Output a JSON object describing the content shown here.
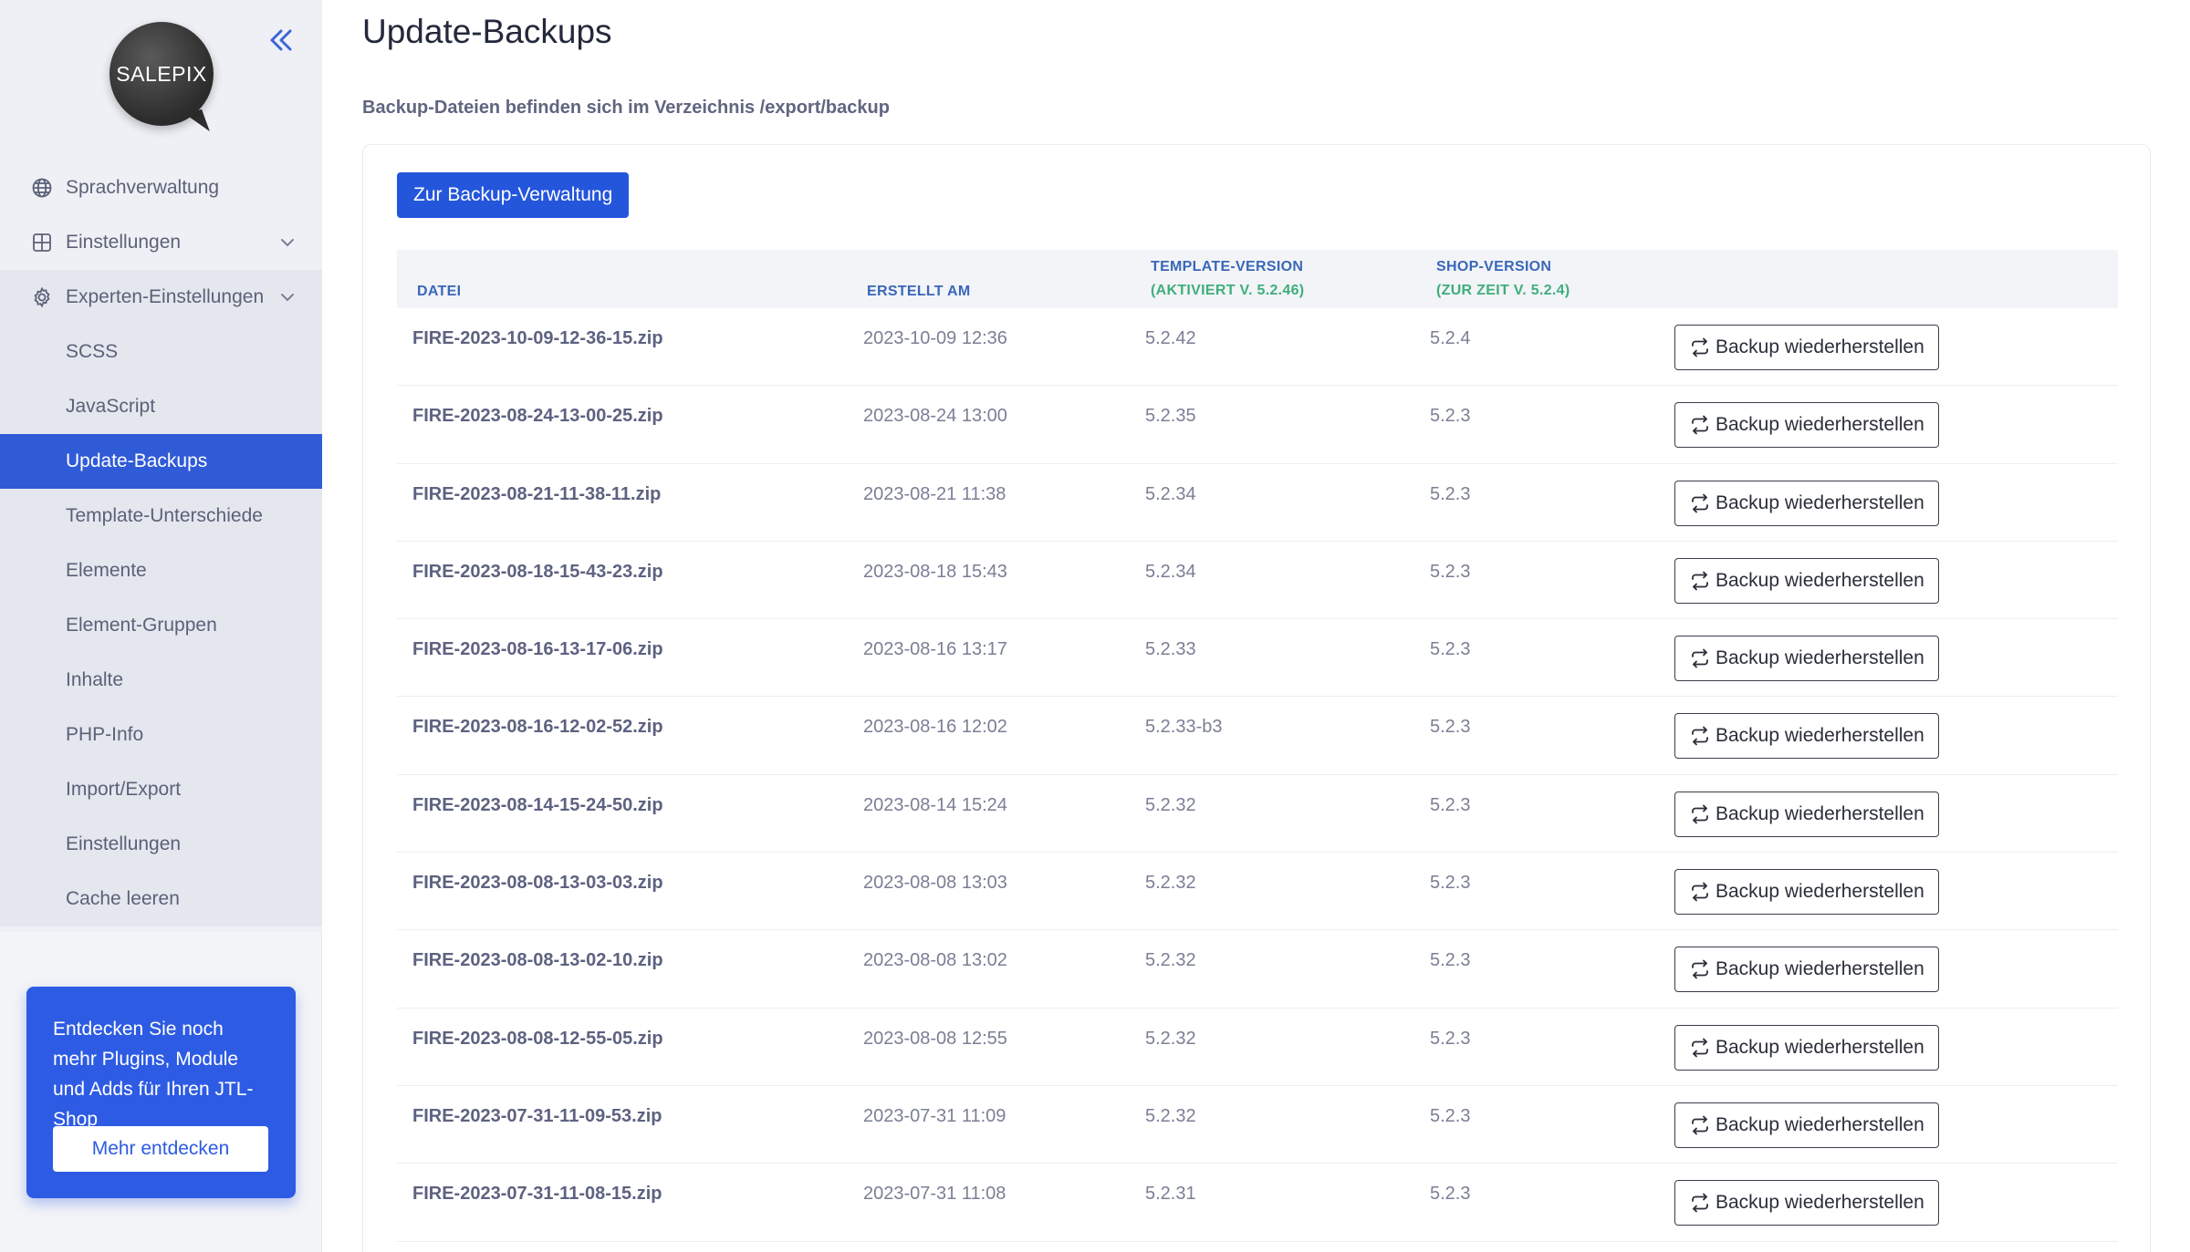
{
  "logo": {
    "text": "SALEPIX"
  },
  "sidebar": {
    "items": [
      {
        "label": "Sprachverwaltung",
        "icon": "globe-icon"
      },
      {
        "label": "Einstellungen",
        "icon": "grid-icon"
      },
      {
        "label": "Experten-Einstellungen",
        "icon": "gear-icon"
      }
    ],
    "subitems": [
      {
        "label": "SCSS"
      },
      {
        "label": "JavaScript"
      },
      {
        "label": "Update-Backups",
        "active": true
      },
      {
        "label": "Template-Unterschiede"
      },
      {
        "label": "Elemente"
      },
      {
        "label": "Element-Gruppen"
      },
      {
        "label": "Inhalte"
      },
      {
        "label": "PHP-Info"
      },
      {
        "label": "Import/Export"
      },
      {
        "label": "Einstellungen"
      },
      {
        "label": "Cache leeren"
      }
    ]
  },
  "promo": {
    "text": "Entdecken Sie noch mehr Plugins, Module und Adds für Ihren JTL-Shop",
    "button": "Mehr entdecken"
  },
  "page": {
    "title": "Update-Backups",
    "subtitle": "Backup-Dateien befinden sich im Verzeichnis /export/backup",
    "primary_button": "Zur Backup-Verwaltung"
  },
  "table": {
    "headers": {
      "file": "DATEI",
      "created": "ERSTELLT AM",
      "template": "TEMPLATE-VERSION",
      "template_sub": "(AKTIVIERT V. 5.2.46)",
      "shop": "SHOP-VERSION",
      "shop_sub": "(ZUR ZEIT V. 5.2.4)"
    },
    "restore_label": "Backup wiederherstellen",
    "rows": [
      {
        "file": "FIRE-2023-10-09-12-36-15.zip",
        "date": "2023-10-09 12:36",
        "template": "5.2.42",
        "shop": "5.2.4"
      },
      {
        "file": "FIRE-2023-08-24-13-00-25.zip",
        "date": "2023-08-24 13:00",
        "template": "5.2.35",
        "shop": "5.2.3"
      },
      {
        "file": "FIRE-2023-08-21-11-38-11.zip",
        "date": "2023-08-21 11:38",
        "template": "5.2.34",
        "shop": "5.2.3"
      },
      {
        "file": "FIRE-2023-08-18-15-43-23.zip",
        "date": "2023-08-18 15:43",
        "template": "5.2.34",
        "shop": "5.2.3"
      },
      {
        "file": "FIRE-2023-08-16-13-17-06.zip",
        "date": "2023-08-16 13:17",
        "template": "5.2.33",
        "shop": "5.2.3"
      },
      {
        "file": "FIRE-2023-08-16-12-02-52.zip",
        "date": "2023-08-16 12:02",
        "template": "5.2.33-b3",
        "shop": "5.2.3"
      },
      {
        "file": "FIRE-2023-08-14-15-24-50.zip",
        "date": "2023-08-14 15:24",
        "template": "5.2.32",
        "shop": "5.2.3"
      },
      {
        "file": "FIRE-2023-08-08-13-03-03.zip",
        "date": "2023-08-08 13:03",
        "template": "5.2.32",
        "shop": "5.2.3"
      },
      {
        "file": "FIRE-2023-08-08-13-02-10.zip",
        "date": "2023-08-08 13:02",
        "template": "5.2.32",
        "shop": "5.2.3"
      },
      {
        "file": "FIRE-2023-08-08-12-55-05.zip",
        "date": "2023-08-08 12:55",
        "template": "5.2.32",
        "shop": "5.2.3"
      },
      {
        "file": "FIRE-2023-07-31-11-09-53.zip",
        "date": "2023-07-31 11:09",
        "template": "5.2.32",
        "shop": "5.2.3"
      },
      {
        "file": "FIRE-2023-07-31-11-08-15.zip",
        "date": "2023-07-31 11:08",
        "template": "5.2.31",
        "shop": "5.2.3"
      }
    ]
  },
  "colors": {
    "accent": "#2456dc",
    "sidebar_bg": "#eef0f5",
    "header_text": "#3a67b8",
    "header_sub_text": "#3fae7c"
  }
}
